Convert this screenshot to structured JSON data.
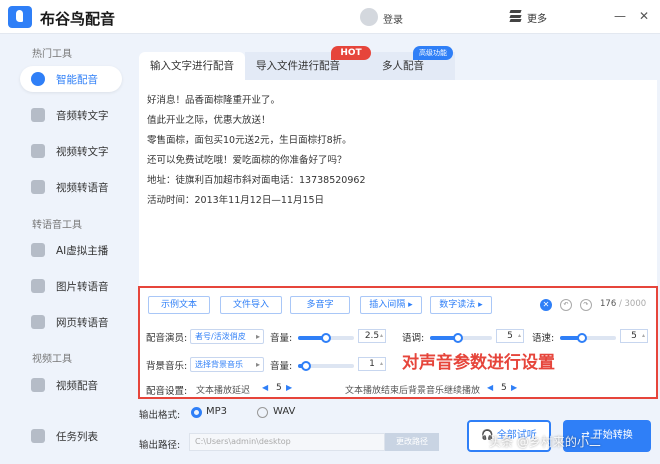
{
  "app": {
    "title": "布谷鸟配音",
    "login": "登录",
    "more": "更多"
  },
  "window": {
    "minimize": "—",
    "close": "✕"
  },
  "sidebar": {
    "sections": [
      "热门工具",
      "转语音工具",
      "视频工具"
    ],
    "items": [
      {
        "label": "智能配音",
        "active": true
      },
      {
        "label": "音频转文字"
      },
      {
        "label": "视频转文字"
      },
      {
        "label": "视频转语音"
      },
      {
        "label": "AI虚拟主播"
      },
      {
        "label": "图片转语音"
      },
      {
        "label": "网页转语音"
      },
      {
        "label": "视频配音"
      },
      {
        "label": "任务列表"
      }
    ]
  },
  "tabs": [
    {
      "label": "输入文字进行配音",
      "active": true
    },
    {
      "label": "导入文件进行配音"
    },
    {
      "label": "多人配音"
    }
  ],
  "badges": {
    "hot": "HOT",
    "advanced": "高级功能"
  },
  "editor": {
    "lines": [
      "好消息！品香面棕隆重开业了。",
      "值此开业之际，优惠大放送！",
      "零售面棕，面包买10元送2元，生日面棕打8折。",
      "还可以免费试吃哦！爱吃面棕的你准备好了吗？",
      "地址：徒旗利百加超市斜对面电话：13738520962",
      "活动时间：2013年11月12日—11月15日"
    ]
  },
  "toolbar": {
    "buttons": [
      "示例文本",
      "文件导入",
      "多音字",
      "插入间隔 ▸",
      "数字读法 ▸"
    ],
    "clear_icon": "✕",
    "char_count": "176",
    "char_max": "/ 3000"
  },
  "settings": {
    "voice_label": "配音演员:",
    "voice_value": "者号/活泼俏皮",
    "bgm_label": "背景音乐:",
    "bgm_value": "选择背景音乐",
    "volume_label": "音量:",
    "volume_value": "2.5",
    "volume_level": 0.5,
    "speed_label": "语调:",
    "speed_value": "5",
    "speed_level": 0.45,
    "rate_label": "语速:",
    "rate_value": "5",
    "rate_level": 0.4,
    "bgm_volume_label": "音量:",
    "bgm_volume_value": "1",
    "bgm_volume_level": 0.15,
    "config_label": "配音设置:",
    "delay_label": "文本播放延迟",
    "delay_value": "5",
    "bgm_continue_label": "文本播放结束后背景音乐继续播放",
    "bgm_continue_value": "5",
    "annotation": "对声音参数进行设置"
  },
  "output": {
    "format_label": "输出格式:",
    "formats": [
      "MP3",
      "WAV"
    ],
    "path_label": "输出路径:",
    "path_value": "C:\\Users\\admin\\desktop",
    "change_dir": "更改路径",
    "audition": "全部试听",
    "start": "开始转换"
  },
  "watermark": "头条 @乡村来的小二",
  "colors": {
    "accent": "#2f7ff7",
    "highlight": "#e6453b"
  }
}
